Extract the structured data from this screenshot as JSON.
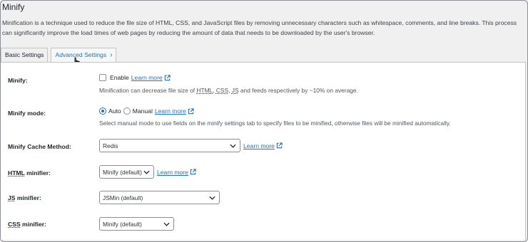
{
  "title": "Minify",
  "intro": "Minification is a technique used to reduce the file size of HTML, CSS, and JavaScript files by removing unnecessary characters such as whitespace, comments, and line breaks. This process can significantly improve the load times of web pages by reducing the amount of data that needs to be downloaded by the user's browser.",
  "tabs": [
    {
      "label": "Basic Settings"
    },
    {
      "label": "Advanced Settings"
    }
  ],
  "rows": {
    "minify": {
      "label": "Minify:",
      "checkbox_label": "Enable",
      "checked": false,
      "link": "Learn more",
      "desc_pre": "Minification can decrease file size of ",
      "desc_html": "HTML",
      "desc_css": "CSS",
      "desc_js": "JS",
      "desc_post": " and feeds respectively by ~10% on average."
    },
    "mode": {
      "label": "Minify mode:",
      "auto": "Auto",
      "manual": "Manual",
      "selected": "Auto",
      "link": "Learn more",
      "desc": "Select manual mode to use fields on the minify settings tab to specify files to be minified, otherwise files will be minified automatically."
    },
    "cache": {
      "label": "Minify Cache Method:",
      "value": "Redis",
      "link": "Learn more"
    },
    "html": {
      "label_abbr": "HTML",
      "label_rest": " minifier:",
      "value": "Minify (default)",
      "link": "Learn more"
    },
    "js": {
      "label_abbr": "JS",
      "label_rest": " minifier:",
      "value": "JSMin (default)"
    },
    "css": {
      "label_abbr": "CSS",
      "label_rest": " minifier:",
      "value": "Minify (default)"
    }
  },
  "colors": {
    "link": "#2271b1",
    "background": "#f0f0f1",
    "panel": "#ffffff"
  }
}
